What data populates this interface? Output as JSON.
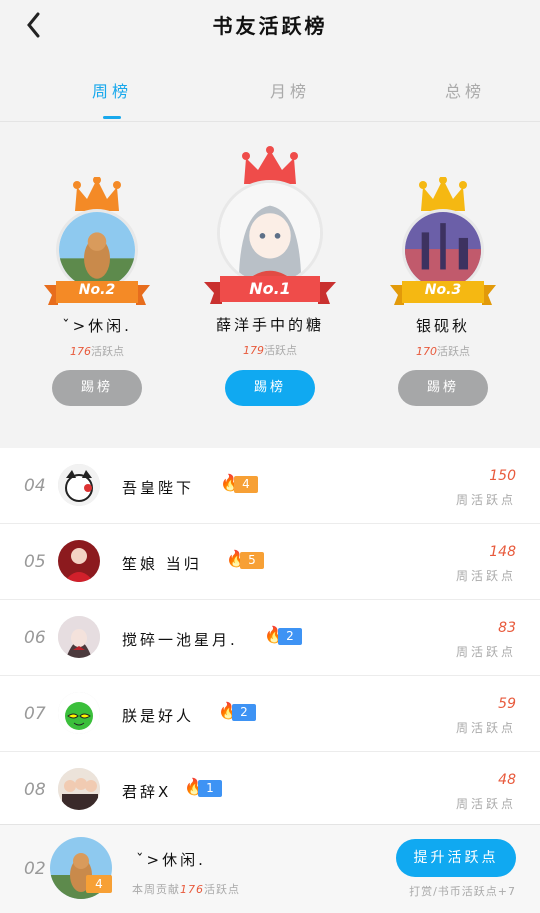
{
  "header": {
    "title": "书友活跃榜"
  },
  "tabs": [
    {
      "label": "周榜",
      "active": true
    },
    {
      "label": "月榜",
      "active": false
    },
    {
      "label": "总榜",
      "active": false
    }
  ],
  "podium": {
    "unit": "活跃点",
    "first": {
      "badge": "No.1",
      "name": "薛洋手中的糖",
      "score": "179",
      "button": "踢榜"
    },
    "second": {
      "badge": "No.2",
      "name": "ˇ>休闲.",
      "score": "176",
      "button": "踢榜"
    },
    "third": {
      "badge": "No.3",
      "name": "银砚秋",
      "score": "170",
      "button": "踢榜"
    }
  },
  "list": {
    "unit_label": "周活跃点",
    "rows": [
      {
        "rank": "04",
        "name": "吾皇陛下",
        "level": "4",
        "flame": "orange",
        "score": "150"
      },
      {
        "rank": "05",
        "name": "笙娘 当归",
        "level": "5",
        "flame": "orange",
        "score": "148"
      },
      {
        "rank": "06",
        "name": "搅碎一池星月.",
        "level": "2",
        "flame": "blue",
        "score": "83"
      },
      {
        "rank": "07",
        "name": "朕是好人",
        "level": "2",
        "flame": "blue",
        "score": "59"
      },
      {
        "rank": "08",
        "name": "君辞X",
        "level": "1",
        "flame": "blue",
        "score": "48"
      }
    ]
  },
  "footer": {
    "rank": "02",
    "name": "ˇ>休闲.",
    "level": "4",
    "sub_prefix": "本周贡献",
    "sub_score": "176",
    "sub_suffix": "活跃点",
    "button": "提升活跃点",
    "note": "打赏/书币活跃点+7"
  },
  "colors": {
    "accent": "#10a9f1",
    "score": "#e85a3c",
    "flame_orange": "#f7a035",
    "flame_blue": "#3e93f4"
  }
}
